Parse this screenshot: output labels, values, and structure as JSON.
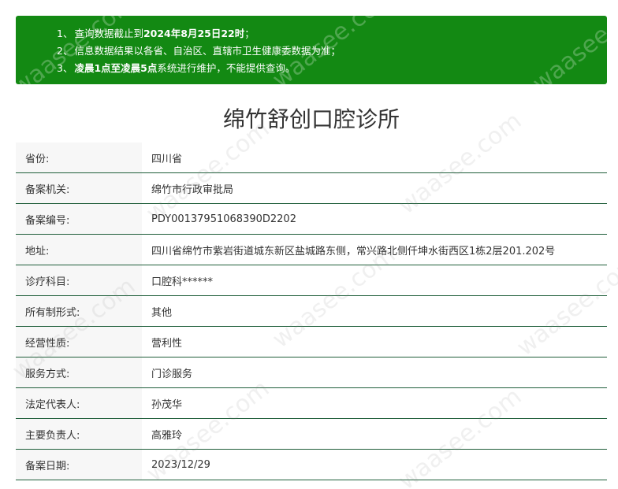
{
  "notice": {
    "line1": {
      "num": "1、",
      "text": "查询数据截止到",
      "bold": "2024年8月25日22时",
      "end": "；"
    },
    "line2": {
      "num": "2、",
      "text": "信息数据结果以各省、自治区、直辖市卫生健康委数据为准；"
    },
    "line3": {
      "num": "3、",
      "bold": "凌晨1点至凌晨5点",
      "text": "系统进行维护，不能提供查询。"
    }
  },
  "title": "绵竹舒创口腔诊所",
  "rows": [
    {
      "label": "省份:",
      "value": "四川省"
    },
    {
      "label": "备案机关:",
      "value": "绵竹市行政审批局"
    },
    {
      "label": "备案编号:",
      "value": "PDY00137951068390D2202"
    },
    {
      "label": "地址:",
      "value": "四川省绵竹市紫岩街道城东新区盐城路东侧，常兴路北侧仟坤水街西区1栋2层201.202号"
    },
    {
      "label": "诊疗科目:",
      "value": "口腔科******"
    },
    {
      "label": "所有制形式:",
      "value": "其他"
    },
    {
      "label": "经营性质:",
      "value": "营利性"
    },
    {
      "label": "服务方式:",
      "value": "门诊服务"
    },
    {
      "label": "法定代表人:",
      "value": "孙茂华"
    },
    {
      "label": "主要负责人:",
      "value": "高雅玲"
    },
    {
      "label": "备案日期:",
      "value": "2023/12/29"
    }
  ],
  "watermark": "waasee.com"
}
